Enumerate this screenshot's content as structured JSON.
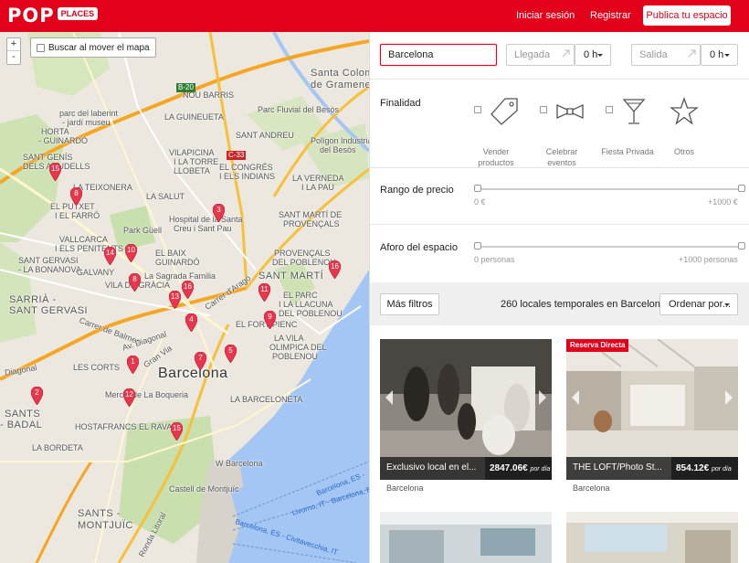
{
  "header": {
    "logo_main": "POP",
    "logo_sub": "PLACES",
    "login_label": "Iniciar sesión",
    "register_label": "Registrar",
    "publish_label": "Publica tu espacio",
    "brand_color": "#e2001a"
  },
  "map": {
    "zoom_in": "+",
    "zoom_out": "-",
    "search_on_move_label": "Buscar al mover el mapa",
    "labels": {
      "santa_coloma": "Santa Coloma",
      "de_gramenet": "de Gramenet",
      "nou_barris": "NOU BARRIS",
      "parc_laberint_1": "parc del laberint",
      "parc_laberint_2": "- jardí museu",
      "parc_besos": "Parc Fluvial del Besòs",
      "la_guineueta": "LA GUINEUETA",
      "sant_andreu": "SANT ANDREU",
      "horta": "HORTA",
      "guinardo": "- GUINARDÓ",
      "poligon_1": "Polígon Industrial",
      "poligon_2": "del Besòs",
      "sant_genis": "SANT GENÍS",
      "dels_agudells": "DELS AGUDELLS",
      "la_teixonera": "LA TEIXONERA",
      "vilapicina_1": "VILAPICINA",
      "vilapicina_2": "I LA TORRE",
      "vilapicina_3": "LLOBETA",
      "el_congres": "EL CONGRÉS",
      "els_indians": "I ELS INDIANS",
      "la_verneda": "LA VERNEDA",
      "la_pau": "I LA PAU",
      "la_salut": "LA SALUT",
      "el_putxet": "EL PUTXET",
      "el_farro": "I EL FARRÓ",
      "hospital_1": "Hospital de la Santa",
      "hospital_2": "Creu i Sant Pau",
      "park_guell": "Park Güell",
      "vallcarca": "VALLCARCA",
      "els_penitents": "I ELS PENITENTS",
      "el_baix": "EL BAIX",
      "guinardo_2": "GUINARDÓ",
      "sant_marti_provencals": "SANT MARTÍ DE",
      "provencals": "PROVENÇALS",
      "provencals_poblenou_1": "PROVENÇALS",
      "provencals_poblenou_2": "DEL POBLENOU",
      "sant_gervasi_1": "SANT GERVASI",
      "sant_gervasi_2": "- LA BONANOVA",
      "la_sagrada_familia": "La Sagrada Familia",
      "sant_marti": "SANT MARTÍ",
      "galvany": "GALVANY",
      "vila_gracia": "VILA DE GRÀCIA",
      "sarria": "SARRIÀ -",
      "sant_gervasi": "SANT GERVASI",
      "el_parc": "EL PARC",
      "la_llacuna": "I LA LLACUNA",
      "del_poblenou": "DEL POBLENOU",
      "el_fort_pienc": "EL FORT PIENC",
      "la_vila_1": "LA VILA",
      "la_vila_2": "OLIMPICA DEL",
      "la_vila_3": "POBLENOU",
      "les_corts": "LES CORTS",
      "barcelona": "Barcelona",
      "boqueria": "Mercat de La Boqueria",
      "barceloneta": "LA BARCELONETA",
      "sants": "SANTS",
      "badal": "- BADAL",
      "hostafrancs": "HOSTAFRANCS",
      "el_raval": "EL RAVAL",
      "la_bordeta": "LA BORDETA",
      "w_barcelona": "W Barcelona",
      "castell": "Castell de Montjuïc",
      "sants_montjuic_1": "SANTS -",
      "sants_montjuic_2": "MONTJUÏC",
      "sea_1": "Barcelona, ES -",
      "sea_2": "Livorno, IT - Barcelona, ES",
      "sea_3": "Barcelona, ES - Civitavecchia, IT",
      "carrer_balmes": "Carrer de Balmes",
      "diagonal": "Av. Diagonal",
      "arago": "Carrer d'Aragó",
      "diagonal_2": "Diagonal",
      "ronda_litoral": "Ronda Litoral",
      "ronda_mig": "Ronda del Mig",
      "av_parallel": "Av. del Parallel",
      "gran_via": "Gran Via",
      "b20": "B-20",
      "c33": "C-33"
    },
    "pins": [
      "15",
      "8",
      "3",
      "14",
      "10",
      "8",
      "16",
      "13",
      "16",
      "11",
      "4",
      "9",
      "7",
      "1",
      "5",
      "2",
      "12",
      "15"
    ]
  },
  "search": {
    "city_value": "Barcelona",
    "arrival_placeholder": "Llegada",
    "arrival_hour": "0 h",
    "departure_placeholder": "Salida",
    "departure_hour": "0 h"
  },
  "filters": {
    "purpose_label": "Finalidad",
    "purposes": [
      {
        "label": "Vender productos",
        "icon": "tag-icon"
      },
      {
        "label": "Celebrar eventos",
        "icon": "bowtie-icon"
      },
      {
        "label": "Fiesta Privada",
        "icon": "cocktail-icon"
      },
      {
        "label": "Otros",
        "icon": "star-icon"
      }
    ],
    "price_label": "Rango de precio",
    "price_min": "0 €",
    "price_max": "+1000 €",
    "capacity_label": "Aforo del espacio",
    "capacity_min": "0 personas",
    "capacity_max": "+1000 personas"
  },
  "results": {
    "more_filters_label": "Más filtros",
    "count_text": "260 locales temporales en Barcelona",
    "sort_label": "Ordenar por...",
    "cards": [
      {
        "title": "Exclusivo local en el...",
        "price": "2847.06€",
        "per": "por día",
        "city": "Barcelona",
        "badge": ""
      },
      {
        "title": "THE LOFT/Photo St...",
        "price": "854.12€",
        "per": "por día",
        "city": "Barcelona",
        "badge": "Reserva Directa"
      }
    ]
  }
}
